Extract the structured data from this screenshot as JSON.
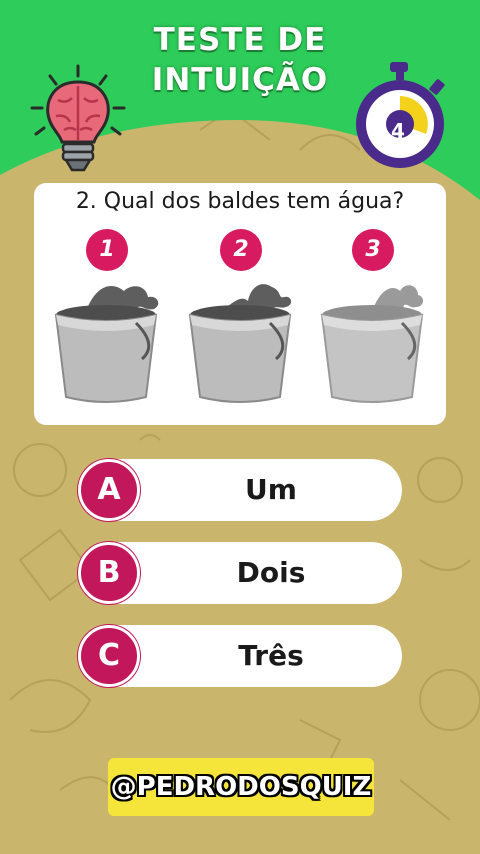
{
  "header": {
    "title_line1": "TESTE DE",
    "title_line2": "INTUIÇÃO",
    "timer_value": "4",
    "timer_progress_fraction": 0.4,
    "icons": [
      "brain-lightbulb-icon",
      "stopwatch-icon"
    ]
  },
  "question": {
    "text": "2. Qual dos baldes tem água?",
    "options": [
      {
        "number": "1"
      },
      {
        "number": "2"
      },
      {
        "number": "3"
      }
    ]
  },
  "answers": [
    {
      "letter": "A",
      "label": "Um"
    },
    {
      "letter": "B",
      "label": "Dois"
    },
    {
      "letter": "C",
      "label": "Três"
    }
  ],
  "footer": {
    "handle": "@PEDRODOSQUIZ"
  },
  "colors": {
    "header_green": "#2ecc5a",
    "background_khaki": "#c9b56c",
    "accent_pink": "#c2185b",
    "timer_purple": "#4a2a8a",
    "timer_yellow": "#f4d21b",
    "handle_yellow": "#f5e53a"
  }
}
